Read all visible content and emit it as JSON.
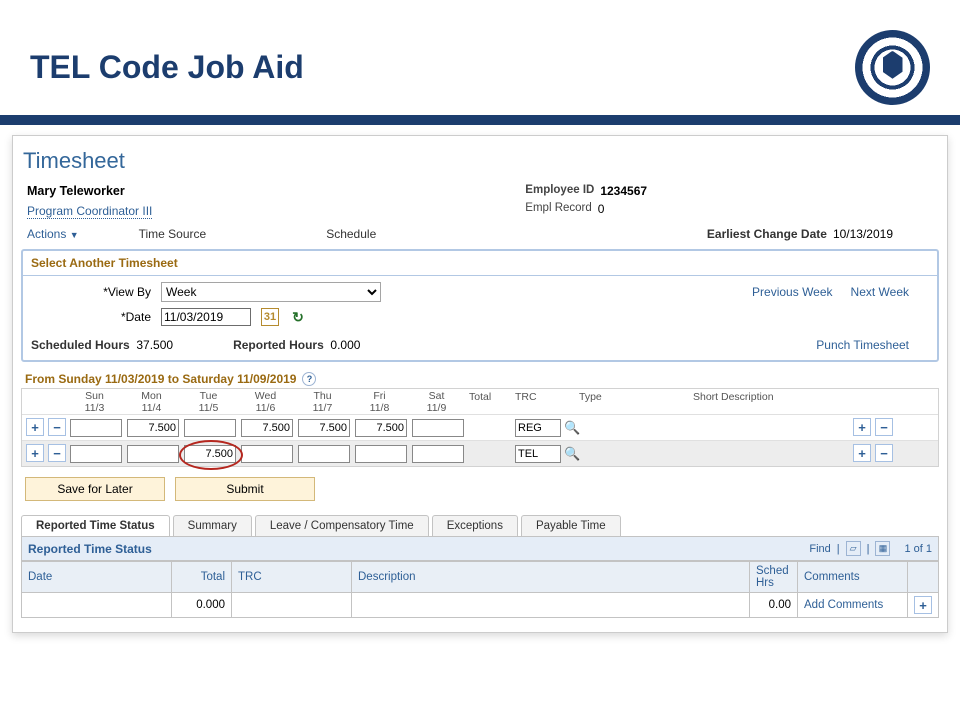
{
  "slide": {
    "title": "TEL Code Job Aid"
  },
  "header": {
    "title": "Timesheet",
    "employee_name": "Mary Teleworker",
    "job_title": "Program Coordinator III",
    "fields": {
      "employee_id_label": "Employee ID",
      "employee_id": "1234567",
      "empl_record_label": "Empl Record",
      "empl_record": "0",
      "earliest_change_label": "Earliest Change Date",
      "earliest_change": "10/13/2019"
    }
  },
  "actions": {
    "menu": "Actions",
    "time_source_label": "Time Source",
    "schedule_label": "Schedule"
  },
  "select_another": {
    "title": "Select Another Timesheet",
    "viewby_label": "*View By",
    "viewby_value": "Week",
    "date_label": "*Date",
    "date_value": "11/03/2019",
    "previous_week": "Previous Week",
    "next_week": "Next Week"
  },
  "hours": {
    "scheduled_label": "Scheduled Hours",
    "scheduled_value": "37.500",
    "reported_label": "Reported Hours",
    "reported_value": "0.000",
    "punch_link": "Punch Timesheet"
  },
  "grid": {
    "range": "From Sunday 11/03/2019 to Saturday 11/09/2019",
    "cols": {
      "total": "Total",
      "trc": "TRC",
      "type": "Type",
      "desc": "Short Description"
    },
    "days": [
      {
        "name": "Sun",
        "date": "11/3"
      },
      {
        "name": "Mon",
        "date": "11/4"
      },
      {
        "name": "Tue",
        "date": "11/5"
      },
      {
        "name": "Wed",
        "date": "11/6"
      },
      {
        "name": "Thu",
        "date": "11/7"
      },
      {
        "name": "Fri",
        "date": "11/8"
      },
      {
        "name": "Sat",
        "date": "11/9"
      }
    ],
    "rows": [
      {
        "trc": "REG",
        "hours": [
          "",
          "7.500",
          "",
          "7.500",
          "7.500",
          "7.500",
          ""
        ]
      },
      {
        "trc": "TEL",
        "hours": [
          "",
          "",
          "7.500",
          "",
          "",
          "",
          ""
        ],
        "highlight_index": 2
      }
    ]
  },
  "buttons": {
    "save": "Save for Later",
    "submit": "Submit"
  },
  "tabs": [
    "Reported Time Status",
    "Summary",
    "Leave / Compensatory Time",
    "Exceptions",
    "Payable Time"
  ],
  "rts": {
    "title": "Reported Time Status",
    "find": "Find",
    "count": "1 of 1",
    "headers": {
      "date": "Date",
      "total": "Total",
      "trc": "TRC",
      "description": "Description",
      "sched": "Sched Hrs",
      "comments": "Comments"
    },
    "row": {
      "date": "",
      "total": "0.000",
      "trc": "",
      "description": "",
      "sched": "0.00",
      "comments": "Add Comments"
    }
  }
}
